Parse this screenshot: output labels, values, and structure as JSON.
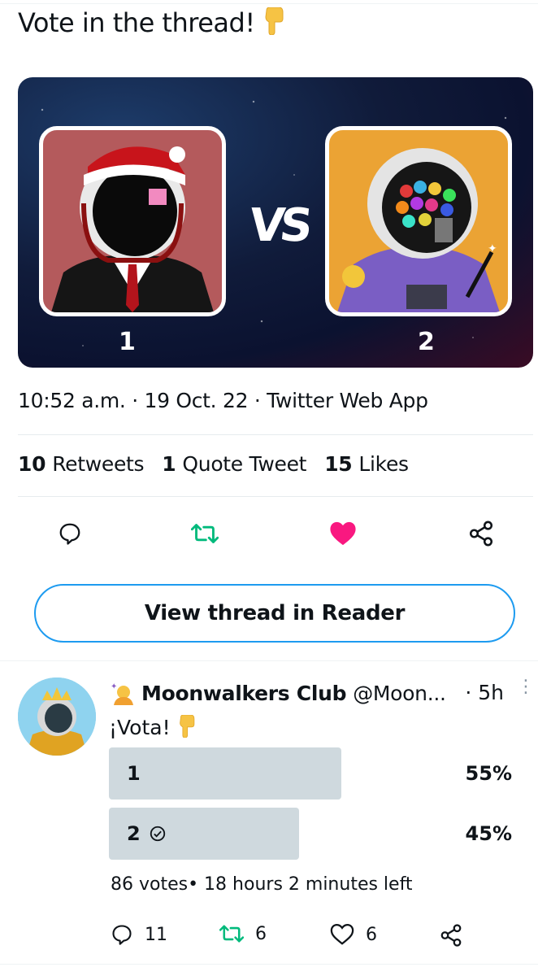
{
  "tweet": {
    "text": "Vote in the thread!",
    "text_emoji": "backhand-index-pointing-down-emoji",
    "media": {
      "left_label": "1",
      "vs_label": "VS",
      "right_label": "2"
    },
    "timestamp": "10:52 a.m. · 19 Oct. 22 · Twitter Web App",
    "stats": {
      "retweets_count": "10",
      "retweets_label": "Retweets",
      "quotes_count": "1",
      "quotes_label": "Quote Tweet",
      "likes_count": "15",
      "likes_label": "Likes"
    },
    "actions": {
      "reply_icon": "comment-icon",
      "retweet_icon": "retweet-icon",
      "like_icon": "heart-filled-icon",
      "share_icon": "share-icon",
      "retweet_color": "#00ba7c",
      "like_color": "#f91880"
    }
  },
  "reader_button": {
    "label": "View thread in Reader"
  },
  "reply": {
    "display_name": "Moonwalkers Club",
    "handle": "@Moon...",
    "time": "· 5h",
    "text": "¡Vota!",
    "poll": {
      "options": [
        {
          "label": "1",
          "percent": "55%",
          "value": 55,
          "selected": false
        },
        {
          "label": "2",
          "percent": "45%",
          "value": 45,
          "selected": true
        }
      ],
      "footer": "86 votes• 18 hours 2 minutes left"
    },
    "actions": {
      "replies": "11",
      "retweets": "6",
      "likes": "6"
    }
  },
  "colors": {
    "accent": "#1d9bf0",
    "poll_bar": "#cfd9de",
    "divider": "#e6ebee"
  }
}
